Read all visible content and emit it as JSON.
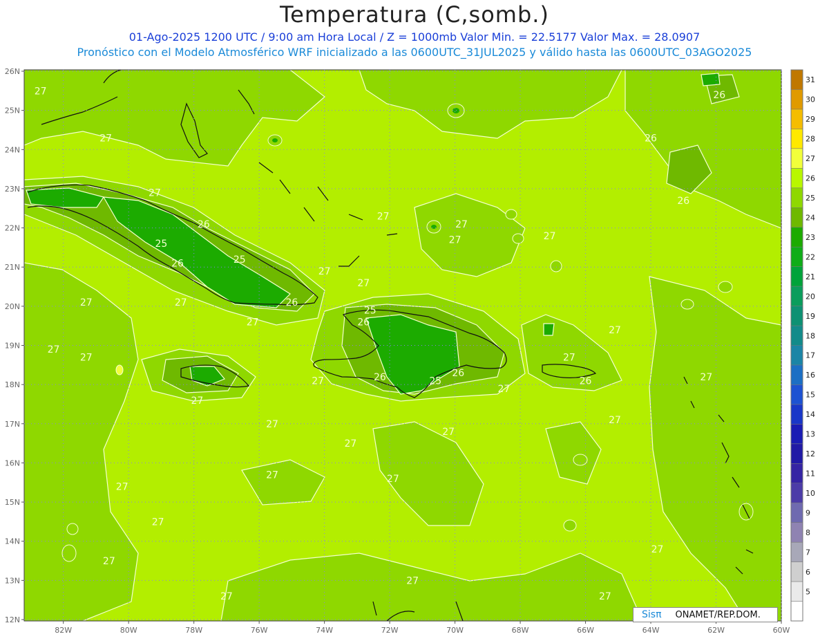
{
  "title": "Temperatura (C,somb.)",
  "subtitle1": "01-Ago-2025  1200 UTC / 9:00 am Hora Local / Z = 1000mb   Valor Min. = 22.5177  Valor Max. = 28.0907",
  "subtitle2": "Pronóstico con el Modelo Atmosférico WRF inicializado a las 0600UTC_31JUL2025 y válido hasta las  0600UTC_03AGO2025",
  "credit": {
    "logo": "Sisπ",
    "org": "ONAMET/REP.DOM."
  },
  "map": {
    "lat_labels": [
      "26N",
      "25N",
      "24N",
      "23N",
      "22N",
      "21N",
      "20N",
      "19N",
      "18N",
      "17N",
      "16N",
      "15N",
      "14N",
      "13N",
      "12N"
    ],
    "lon_labels": [
      "82W",
      "80W",
      "78W",
      "76W",
      "74W",
      "72W",
      "70W",
      "68W",
      "66W",
      "64W",
      "62W",
      "60W"
    ],
    "lat_range": [
      12,
      26
    ],
    "lon_range": [
      -83.2,
      -60
    ],
    "contour_labels": [
      {
        "text": "27",
        "lon": -82.7,
        "lat": 25.5
      },
      {
        "text": "27",
        "lon": -80.7,
        "lat": 24.3
      },
      {
        "text": "27",
        "lon": -79.2,
        "lat": 22.9
      },
      {
        "text": "26",
        "lon": -77.7,
        "lat": 22.1
      },
      {
        "text": "25",
        "lon": -79.0,
        "lat": 21.6
      },
      {
        "text": "26",
        "lon": -78.5,
        "lat": 21.1
      },
      {
        "text": "25",
        "lon": -76.6,
        "lat": 21.2
      },
      {
        "text": "27",
        "lon": -74.0,
        "lat": 20.9
      },
      {
        "text": "27",
        "lon": -72.8,
        "lat": 20.6
      },
      {
        "text": "27",
        "lon": -72.2,
        "lat": 22.3
      },
      {
        "text": "27",
        "lon": -69.8,
        "lat": 22.1
      },
      {
        "text": "27",
        "lon": -70.0,
        "lat": 21.7
      },
      {
        "text": "27",
        "lon": -67.1,
        "lat": 21.8
      },
      {
        "text": "26",
        "lon": -63.0,
        "lat": 22.7
      },
      {
        "text": "26",
        "lon": -64.0,
        "lat": 24.3
      },
      {
        "text": "26",
        "lon": -61.9,
        "lat": 25.4
      },
      {
        "text": "27",
        "lon": -81.3,
        "lat": 20.1
      },
      {
        "text": "27",
        "lon": -78.4,
        "lat": 20.1
      },
      {
        "text": "26",
        "lon": -75.0,
        "lat": 20.1
      },
      {
        "text": "27",
        "lon": -76.2,
        "lat": 19.6
      },
      {
        "text": "25",
        "lon": -72.6,
        "lat": 19.9
      },
      {
        "text": "26",
        "lon": -72.8,
        "lat": 19.6
      },
      {
        "text": "27",
        "lon": -65.1,
        "lat": 19.4
      },
      {
        "text": "27",
        "lon": -82.3,
        "lat": 18.9
      },
      {
        "text": "27",
        "lon": -81.3,
        "lat": 18.7
      },
      {
        "text": "27",
        "lon": -66.5,
        "lat": 18.7
      },
      {
        "text": "26",
        "lon": -72.3,
        "lat": 18.2
      },
      {
        "text": "25",
        "lon": -70.6,
        "lat": 18.1
      },
      {
        "text": "26",
        "lon": -69.9,
        "lat": 18.3
      },
      {
        "text": "27",
        "lon": -74.2,
        "lat": 18.1
      },
      {
        "text": "27",
        "lon": -68.5,
        "lat": 17.9
      },
      {
        "text": "26",
        "lon": -66.0,
        "lat": 18.1
      },
      {
        "text": "27",
        "lon": -62.3,
        "lat": 18.2
      },
      {
        "text": "27",
        "lon": -77.9,
        "lat": 17.6
      },
      {
        "text": "27",
        "lon": -75.6,
        "lat": 17.0
      },
      {
        "text": "27",
        "lon": -65.1,
        "lat": 17.1
      },
      {
        "text": "27",
        "lon": -70.2,
        "lat": 16.8
      },
      {
        "text": "27",
        "lon": -73.2,
        "lat": 16.5
      },
      {
        "text": "27",
        "lon": -75.6,
        "lat": 15.7
      },
      {
        "text": "27",
        "lon": -71.9,
        "lat": 15.6
      },
      {
        "text": "27",
        "lon": -80.2,
        "lat": 15.4
      },
      {
        "text": "27",
        "lon": -79.1,
        "lat": 14.5
      },
      {
        "text": "27",
        "lon": -63.8,
        "lat": 13.8
      },
      {
        "text": "27",
        "lon": -80.6,
        "lat": 13.5
      },
      {
        "text": "27",
        "lon": -71.3,
        "lat": 13.0
      },
      {
        "text": "27",
        "lon": -77.0,
        "lat": 12.6
      },
      {
        "text": "27",
        "lon": -65.4,
        "lat": 12.6
      }
    ]
  },
  "colorbar": {
    "labels": [
      "31",
      "30",
      "29",
      "28",
      "27",
      "26",
      "25",
      "24",
      "23",
      "22",
      "21",
      "20",
      "19",
      "18",
      "17",
      "16",
      "15",
      "14",
      "13",
      "12",
      "11",
      "10",
      "9",
      "8",
      "7",
      "6",
      "5"
    ],
    "colors": [
      "#c07800",
      "#e09a00",
      "#f5bd00",
      "#ffe900",
      "#f2ff3a",
      "#b9f700",
      "#8fd800",
      "#6fb900",
      "#1cab00",
      "#0fad18",
      "#00a33a",
      "#0a9d5c",
      "#0d9173",
      "#128b8a",
      "#1b85a6",
      "#1c6fc4",
      "#1d52d2",
      "#1937c8",
      "#1a1cb4",
      "#211aa6",
      "#3524a4",
      "#4c3ca8",
      "#6f6ab0",
      "#8f83b2",
      "#a8a8b8",
      "#cfcfcf",
      "#eaeaea",
      "#ffffff"
    ]
  }
}
